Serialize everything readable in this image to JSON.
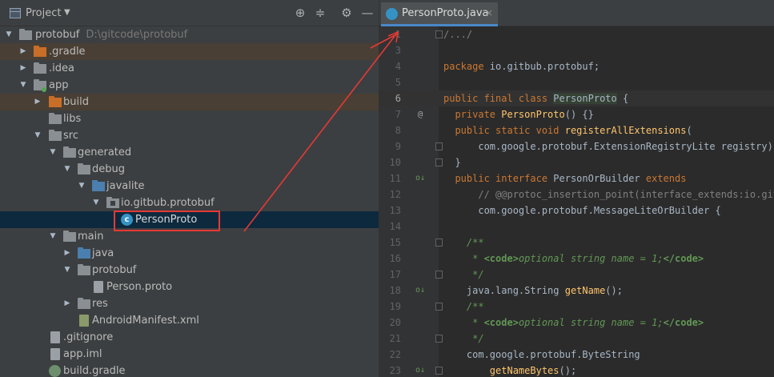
{
  "project_panel": {
    "title": "Project",
    "tree": [
      {
        "label": "protobuf",
        "hint": "D:\\gitcode\\protobuf"
      },
      {
        "label": ".gradle"
      },
      {
        "label": ".idea"
      },
      {
        "label": "app"
      },
      {
        "label": "build"
      },
      {
        "label": "libs"
      },
      {
        "label": "src"
      },
      {
        "label": "generated"
      },
      {
        "label": "debug"
      },
      {
        "label": "javalite"
      },
      {
        "label": "io.gitbub.protobuf"
      },
      {
        "label": "PersonProto"
      },
      {
        "label": "main"
      },
      {
        "label": "java"
      },
      {
        "label": "protobuf"
      },
      {
        "label": "Person.proto"
      },
      {
        "label": "res"
      },
      {
        "label": "AndroidManifest.xml"
      },
      {
        "label": ".gitignore"
      },
      {
        "label": "app.iml"
      },
      {
        "label": "build.gradle"
      }
    ]
  },
  "editor": {
    "tab_label": "PersonProto.java",
    "tab_close": "×",
    "line_numbers": [
      "1",
      "3",
      "4",
      "5",
      "6",
      "7",
      "8",
      "9",
      "10",
      "11",
      "12",
      "13",
      "14",
      "15",
      "16",
      "17",
      "18",
      "19",
      "20",
      "21",
      "22",
      "23"
    ],
    "code": {
      "l1": "/.../",
      "l4a": "package ",
      "l4b": "io.gitbub.protobuf;",
      "l6a": "public final class ",
      "l6b": "PersonProto",
      "l6c": " {",
      "l7a": "  private ",
      "l7b": "PersonProto",
      "l7c": "() {}",
      "l8a": "  public static void ",
      "l8b": "registerAllExtensions",
      "l8c": "(",
      "l9": "      com.google.protobuf.ExtensionRegistryLite registry) {",
      "l10": "  }",
      "l11a": "  public interface ",
      "l11b": "PersonOrBuilder ",
      "l11c": "extends",
      "l12": "      // @@protoc_insertion_point(interface_extends:io.gitb",
      "l13": "      com.google.protobuf.MessageLiteOrBuilder {",
      "l15": "    /**",
      "l16a": "     * ",
      "l16b": "<code>",
      "l16c": "optional string name = 1;",
      "l16d": "</code>",
      "l17": "     */",
      "l18a": "    java.lang.String ",
      "l18b": "getName",
      "l18c": "();",
      "l19": "    /**",
      "l20a": "     * ",
      "l20b": "<code>",
      "l20c": "optional string name = 1;",
      "l20d": "</code>",
      "l21": "     */",
      "l22": "    com.google.protobuf.ByteString",
      "l23a": "        ",
      "l23b": "getNameBytes",
      "l23c": "();"
    },
    "gutter_marks": {
      "override": "@",
      "implemented": "o↓"
    }
  },
  "colors": {
    "annotation": "#e53935",
    "selection": "#0d293e",
    "tab_underline": "#4a88c7"
  }
}
